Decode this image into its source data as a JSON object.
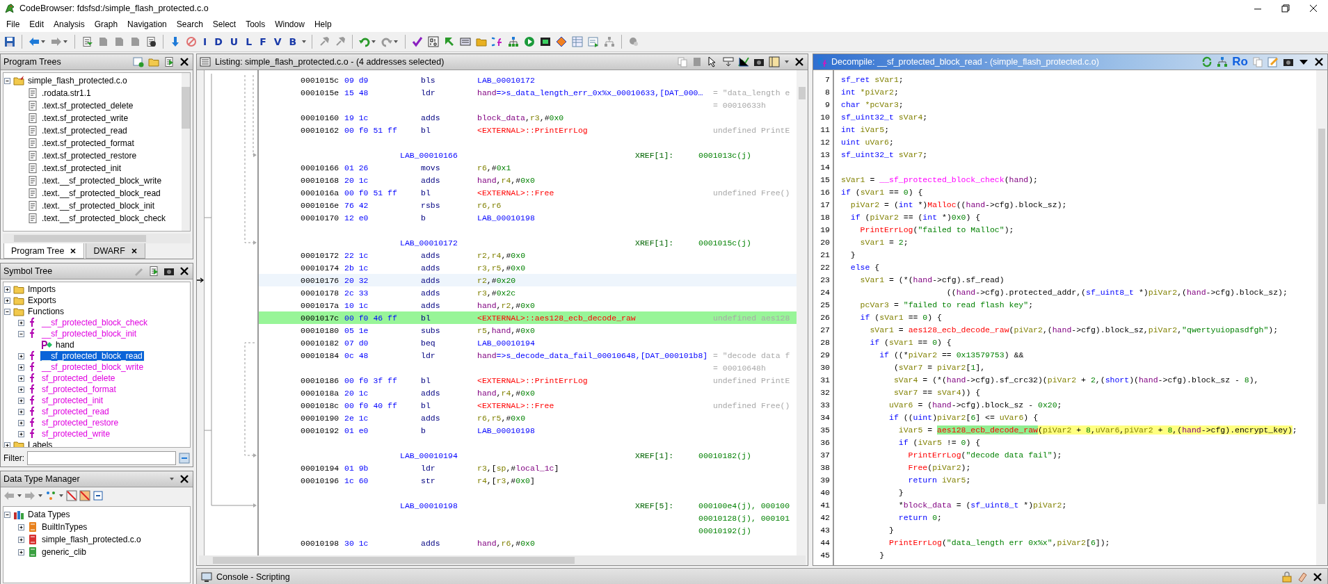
{
  "window": {
    "title": "CodeBrowser: fdsfsd:/simple_flash_protected.c.o"
  },
  "menu": [
    "File",
    "Edit",
    "Analysis",
    "Graph",
    "Navigation",
    "Search",
    "Select",
    "Tools",
    "Window",
    "Help"
  ],
  "toolbar": {
    "letter_buttons": [
      "I",
      "D",
      "U",
      "L",
      "F",
      "V",
      "B"
    ]
  },
  "program_trees": {
    "title": "Program Trees",
    "items": [
      {
        "label": "simple_flash_protected.c.o",
        "kind": "root",
        "expanded": true,
        "children": [
          {
            "label": ".rodata.str1.1",
            "kind": "fragment"
          },
          {
            "label": ".text.sf_protected_delete",
            "kind": "fragment"
          },
          {
            "label": ".text.sf_protected_write",
            "kind": "fragment"
          },
          {
            "label": ".text.sf_protected_read",
            "kind": "fragment"
          },
          {
            "label": ".text.sf_protected_format",
            "kind": "fragment"
          },
          {
            "label": ".text.sf_protected_restore",
            "kind": "fragment"
          },
          {
            "label": ".text.sf_protected_init",
            "kind": "fragment"
          },
          {
            "label": ".text.__sf_protected_block_write",
            "kind": "fragment"
          },
          {
            "label": ".text.__sf_protected_block_read",
            "kind": "fragment"
          },
          {
            "label": ".text.__sf_protected_block_init",
            "kind": "fragment"
          },
          {
            "label": ".text.__sf_protected_block_check",
            "kind": "fragment"
          }
        ]
      }
    ],
    "tabs": [
      {
        "label": "Program Tree",
        "selected": true
      },
      {
        "label": "DWARF",
        "selected": false
      }
    ]
  },
  "symbol_tree": {
    "title": "Symbol Tree",
    "items": [
      {
        "label": "Imports",
        "kind": "folder",
        "expanded": false,
        "selected": false
      },
      {
        "label": "Exports",
        "kind": "folder",
        "expanded": false,
        "selected": false
      },
      {
        "label": "Functions",
        "kind": "folder",
        "expanded": true,
        "selected": false,
        "children": [
          {
            "label": "__sf_protected_block_check",
            "kind": "function",
            "expanded": false,
            "selected": false
          },
          {
            "label": "__sf_protected_block_init",
            "kind": "function",
            "expanded": true,
            "selected": false,
            "children": [
              {
                "label": "hand",
                "kind": "param",
                "selected": false
              }
            ]
          },
          {
            "label": "__sf_protected_block_read",
            "kind": "function",
            "expanded": false,
            "selected": true
          },
          {
            "label": "__sf_protected_block_write",
            "kind": "function",
            "expanded": false,
            "selected": false
          },
          {
            "label": "sf_protected_delete",
            "kind": "function",
            "expanded": false,
            "selected": false
          },
          {
            "label": "sf_protected_format",
            "kind": "function",
            "expanded": false,
            "selected": false
          },
          {
            "label": "sf_protected_init",
            "kind": "function",
            "expanded": false,
            "selected": false
          },
          {
            "label": "sf_protected_read",
            "kind": "function",
            "expanded": false,
            "selected": false
          },
          {
            "label": "sf_protected_restore",
            "kind": "function",
            "expanded": false,
            "selected": false
          },
          {
            "label": "sf_protected_write",
            "kind": "function",
            "expanded": false,
            "selected": false
          }
        ]
      },
      {
        "label": "Labels",
        "kind": "folder",
        "expanded": false,
        "selected": false
      }
    ],
    "filter": {
      "label": "Filter:"
    }
  },
  "data_type_manager": {
    "title": "Data Type Manager",
    "items": [
      {
        "label": "Data Types",
        "kind": "root",
        "expanded": true,
        "children": [
          {
            "label": "BuiltInTypes",
            "kind": "archive",
            "color": "#e8801c",
            "expanded": false
          },
          {
            "label": "simple_flash_protected.c.o",
            "kind": "archive",
            "color": "#d83030",
            "expanded": false
          },
          {
            "label": "generic_clib",
            "kind": "archive",
            "color": "#3aa040",
            "expanded": false
          }
        ]
      }
    ]
  },
  "listing": {
    "title": "Listing:  simple_flash_protected.c.o - (4 addresses selected)",
    "rows": [
      {
        "kind": "instr",
        "address": "0001015c",
        "bytes": "09 d9",
        "mnemonic": "bls",
        "operands": [
          {
            "kind": "label",
            "text": "LAB_00010172"
          }
        ],
        "selected": false,
        "cursor": false
      },
      {
        "kind": "instr",
        "address": "0001015e",
        "bytes": "15 48",
        "mnemonic": "ldr",
        "operands": [
          {
            "kind": "param",
            "text": "hand"
          },
          {
            "kind": "label",
            "text": "=>s_data_length_err_0x%x_00010633,[DAT_000…"
          }
        ],
        "comment": "= \"data_length e",
        "selected": false,
        "cursor": false
      },
      {
        "kind": "note",
        "comment": "= 00010633h"
      },
      {
        "kind": "instr",
        "address": "00010160",
        "bytes": "19 1c",
        "mnemonic": "adds",
        "operands": [
          {
            "kind": "param",
            "text": "block_data"
          },
          {
            "kind": "plain",
            "text": ","
          },
          {
            "kind": "reg",
            "text": "r3"
          },
          {
            "kind": "plain",
            "text": ",#"
          },
          {
            "kind": "num",
            "text": "0x0"
          }
        ],
        "selected": false,
        "cursor": false
      },
      {
        "kind": "instr",
        "address": "00010162",
        "bytes": "00 f0 51 ff",
        "mnemonic": "bl",
        "operands": [
          {
            "kind": "ext",
            "text": "<EXTERNAL>::PrintErrLog"
          }
        ],
        "comment": "undefined PrintE",
        "selected": false,
        "cursor": false
      },
      {
        "kind": "blank"
      },
      {
        "kind": "label",
        "label": "LAB_00010166",
        "xref": "XREF[1]:",
        "refs": [
          "0001013c(j)"
        ]
      },
      {
        "kind": "instr",
        "address": "00010166",
        "bytes": "01 26",
        "mnemonic": "movs",
        "operands": [
          {
            "kind": "reg",
            "text": "r6"
          },
          {
            "kind": "plain",
            "text": ",#"
          },
          {
            "kind": "num",
            "text": "0x1"
          }
        ],
        "selected": false,
        "cursor": false
      },
      {
        "kind": "instr",
        "address": "00010168",
        "bytes": "20 1c",
        "mnemonic": "adds",
        "operands": [
          {
            "kind": "param",
            "text": "hand"
          },
          {
            "kind": "plain",
            "text": ","
          },
          {
            "kind": "reg",
            "text": "r4"
          },
          {
            "kind": "plain",
            "text": ",#"
          },
          {
            "kind": "num",
            "text": "0x0"
          }
        ],
        "selected": false,
        "cursor": false
      },
      {
        "kind": "instr",
        "address": "0001016a",
        "bytes": "00 f0 51 ff",
        "mnemonic": "bl",
        "operands": [
          {
            "kind": "ext",
            "text": "<EXTERNAL>::Free"
          }
        ],
        "comment": "undefined Free()",
        "selected": false,
        "cursor": false
      },
      {
        "kind": "instr",
        "address": "0001016e",
        "bytes": "76 42",
        "mnemonic": "rsbs",
        "operands": [
          {
            "kind": "reg",
            "text": "r6,r6"
          }
        ],
        "selected": false,
        "cursor": false
      },
      {
        "kind": "instr",
        "address": "00010170",
        "bytes": "12 e0",
        "mnemonic": "b",
        "operands": [
          {
            "kind": "label",
            "text": "LAB_00010198"
          }
        ],
        "selected": false,
        "cursor": false
      },
      {
        "kind": "blank"
      },
      {
        "kind": "label",
        "label": "LAB_00010172",
        "xref": "XREF[1]:",
        "refs": [
          "0001015c(j)"
        ]
      },
      {
        "kind": "instr",
        "address": "00010172",
        "bytes": "22 1c",
        "mnemonic": "adds",
        "operands": [
          {
            "kind": "reg",
            "text": "r2,r4"
          },
          {
            "kind": "plain",
            "text": ",#"
          },
          {
            "kind": "num",
            "text": "0x0"
          }
        ],
        "selected": false,
        "cursor": false
      },
      {
        "kind": "instr",
        "address": "00010174",
        "bytes": "2b 1c",
        "mnemonic": "adds",
        "operands": [
          {
            "kind": "reg",
            "text": "r3,r5"
          },
          {
            "kind": "plain",
            "text": ",#"
          },
          {
            "kind": "num",
            "text": "0x0"
          }
        ],
        "selected": false,
        "cursor": false
      },
      {
        "kind": "instr",
        "address": "00010176",
        "bytes": "20 32",
        "mnemonic": "adds",
        "operands": [
          {
            "kind": "reg",
            "text": "r2"
          },
          {
            "kind": "plain",
            "text": ",#"
          },
          {
            "kind": "num",
            "text": "0x20"
          }
        ],
        "selected": false,
        "cursor": true
      },
      {
        "kind": "instr",
        "address": "00010178",
        "bytes": "2c 33",
        "mnemonic": "adds",
        "operands": [
          {
            "kind": "reg",
            "text": "r3"
          },
          {
            "kind": "plain",
            "text": ",#"
          },
          {
            "kind": "num",
            "text": "0x2c"
          }
        ],
        "selected": false,
        "cursor": false
      },
      {
        "kind": "instr",
        "address": "0001017a",
        "bytes": "10 1c",
        "mnemonic": "adds",
        "operands": [
          {
            "kind": "param",
            "text": "hand"
          },
          {
            "kind": "plain",
            "text": ","
          },
          {
            "kind": "reg",
            "text": "r2"
          },
          {
            "kind": "plain",
            "text": ",#"
          },
          {
            "kind": "num",
            "text": "0x0"
          }
        ],
        "selected": false,
        "cursor": false
      },
      {
        "kind": "instr",
        "address": "0001017c",
        "bytes": "00 f0 46 ff",
        "mnemonic": "bl",
        "operands": [
          {
            "kind": "ext",
            "text": "<EXTERNAL>::aes128_ecb_decode_raw"
          }
        ],
        "comment": "undefined aes128",
        "selected": true,
        "cursor": false
      },
      {
        "kind": "instr",
        "address": "00010180",
        "bytes": "05 1e",
        "mnemonic": "subs",
        "operands": [
          {
            "kind": "reg",
            "text": "r5"
          },
          {
            "kind": "plain",
            "text": ","
          },
          {
            "kind": "param",
            "text": "hand"
          },
          {
            "kind": "plain",
            "text": ",#"
          },
          {
            "kind": "num",
            "text": "0x0"
          }
        ],
        "selected": false,
        "cursor": false
      },
      {
        "kind": "instr",
        "address": "00010182",
        "bytes": "07 d0",
        "mnemonic": "beq",
        "operands": [
          {
            "kind": "label",
            "text": "LAB_00010194"
          }
        ],
        "selected": false,
        "cursor": false
      },
      {
        "kind": "instr",
        "address": "00010184",
        "bytes": "0c 48",
        "mnemonic": "ldr",
        "operands": [
          {
            "kind": "param",
            "text": "hand"
          },
          {
            "kind": "label",
            "text": "=>s_decode_data_fail_00010648,[DAT_000101b8]"
          }
        ],
        "comment": "= \"decode data f",
        "selected": false,
        "cursor": false
      },
      {
        "kind": "note",
        "comment": "= 00010648h"
      },
      {
        "kind": "instr",
        "address": "00010186",
        "bytes": "00 f0 3f ff",
        "mnemonic": "bl",
        "operands": [
          {
            "kind": "ext",
            "text": "<EXTERNAL>::PrintErrLog"
          }
        ],
        "comment": "undefined PrintE",
        "selected": false,
        "cursor": false
      },
      {
        "kind": "instr",
        "address": "0001018a",
        "bytes": "20 1c",
        "mnemonic": "adds",
        "operands": [
          {
            "kind": "param",
            "text": "hand"
          },
          {
            "kind": "plain",
            "text": ","
          },
          {
            "kind": "reg",
            "text": "r4"
          },
          {
            "kind": "plain",
            "text": ",#"
          },
          {
            "kind": "num",
            "text": "0x0"
          }
        ],
        "selected": false,
        "cursor": false
      },
      {
        "kind": "instr",
        "address": "0001018c",
        "bytes": "00 f0 40 ff",
        "mnemonic": "bl",
        "operands": [
          {
            "kind": "ext",
            "text": "<EXTERNAL>::Free"
          }
        ],
        "comment": "undefined Free()",
        "selected": false,
        "cursor": false
      },
      {
        "kind": "instr",
        "address": "00010190",
        "bytes": "2e 1c",
        "mnemonic": "adds",
        "operands": [
          {
            "kind": "reg",
            "text": "r6,r5"
          },
          {
            "kind": "plain",
            "text": ",#"
          },
          {
            "kind": "num",
            "text": "0x0"
          }
        ],
        "selected": false,
        "cursor": false
      },
      {
        "kind": "instr",
        "address": "00010192",
        "bytes": "01 e0",
        "mnemonic": "b",
        "operands": [
          {
            "kind": "label",
            "text": "LAB_00010198"
          }
        ],
        "selected": false,
        "cursor": false
      },
      {
        "kind": "blank"
      },
      {
        "kind": "label",
        "label": "LAB_00010194",
        "xref": "XREF[1]:",
        "refs": [
          "00010182(j)"
        ]
      },
      {
        "kind": "instr",
        "address": "00010194",
        "bytes": "01 9b",
        "mnemonic": "ldr",
        "operands": [
          {
            "kind": "reg",
            "text": "r3"
          },
          {
            "kind": "plain",
            "text": ",["
          },
          {
            "kind": "reg",
            "text": "sp"
          },
          {
            "kind": "plain",
            "text": ",#"
          },
          {
            "kind": "param",
            "text": "local_1c"
          },
          {
            "kind": "plain",
            "text": "]"
          }
        ],
        "selected": false,
        "cursor": false
      },
      {
        "kind": "instr",
        "address": "00010196",
        "bytes": "1c 60",
        "mnemonic": "str",
        "operands": [
          {
            "kind": "reg",
            "text": "r4"
          },
          {
            "kind": "plain",
            "text": ",["
          },
          {
            "kind": "reg",
            "text": "r3"
          },
          {
            "kind": "plain",
            "text": ",#"
          },
          {
            "kind": "num",
            "text": "0x0"
          },
          {
            "kind": "plain",
            "text": "]"
          }
        ],
        "selected": false,
        "cursor": false
      },
      {
        "kind": "blank"
      },
      {
        "kind": "label",
        "label": "LAB_00010198",
        "xref": "XREF[5]:",
        "refs": [
          "000100e4(j), 000100",
          "00010128(j), 000101",
          "00010192(j)"
        ]
      },
      {
        "kind": "instr",
        "address": "00010198",
        "bytes": "30 1c",
        "mnemonic": "adds",
        "operands": [
          {
            "kind": "param",
            "text": "hand"
          },
          {
            "kind": "plain",
            "text": ","
          },
          {
            "kind": "reg",
            "text": "r6"
          },
          {
            "kind": "plain",
            "text": ",#"
          },
          {
            "kind": "num",
            "text": "0x0"
          }
        ],
        "selected": false,
        "cursor": false
      }
    ]
  },
  "decompile": {
    "title": "Decompile: __sf_protected_block_read -  (simple_flash_protected.c.o)",
    "badge": "Ro",
    "lines": [
      {
        "number": "7",
        "code": [
          {
            "kind": "kw",
            "text": "sf_ret"
          },
          {
            "kind": "var",
            "text": " sVar1"
          },
          {
            "kind": "plain",
            "text": ";"
          }
        ]
      },
      {
        "number": "8",
        "code": [
          {
            "kind": "kw",
            "text": "int"
          },
          {
            "kind": "var",
            "text": " *piVar2"
          },
          {
            "kind": "plain",
            "text": ";"
          }
        ]
      },
      {
        "number": "9",
        "code": [
          {
            "kind": "kw",
            "text": "char"
          },
          {
            "kind": "var",
            "text": " *pcVar3"
          },
          {
            "kind": "plain",
            "text": ";"
          }
        ]
      },
      {
        "number": "10",
        "code": [
          {
            "kind": "kw",
            "text": "sf_uint32_t"
          },
          {
            "kind": "var",
            "text": " sVar4"
          },
          {
            "kind": "plain",
            "text": ";"
          }
        ]
      },
      {
        "number": "11",
        "code": [
          {
            "kind": "kw",
            "text": "int"
          },
          {
            "kind": "var",
            "text": " iVar5"
          },
          {
            "kind": "plain",
            "text": ";"
          }
        ]
      },
      {
        "number": "12",
        "code": [
          {
            "kind": "kw",
            "text": "uint"
          },
          {
            "kind": "var",
            "text": " uVar6"
          },
          {
            "kind": "plain",
            "text": ";"
          }
        ]
      },
      {
        "number": "13",
        "code": [
          {
            "kind": "kw",
            "text": "sf_uint32_t"
          },
          {
            "kind": "var",
            "text": " sVar7"
          },
          {
            "kind": "plain",
            "text": ";"
          }
        ]
      },
      {
        "number": "14"
      },
      {
        "number": "15",
        "code": [
          {
            "kind": "var",
            "text": "sVar1"
          },
          {
            "kind": "plain",
            "text": " = "
          },
          {
            "kind": "fn",
            "text": "__sf_protected_block_check"
          },
          {
            "kind": "plain",
            "text": "("
          },
          {
            "kind": "param",
            "text": "hand"
          },
          {
            "kind": "plain",
            "text": ");"
          }
        ]
      },
      {
        "number": "16",
        "code": [
          {
            "kind": "kw",
            "text": "if"
          },
          {
            "kind": "plain",
            "text": " ("
          },
          {
            "kind": "var",
            "text": "sVar1"
          },
          {
            "kind": "plain",
            "text": " == "
          },
          {
            "kind": "num",
            "text": "0"
          },
          {
            "kind": "plain",
            "text": ") {"
          }
        ]
      },
      {
        "number": "17",
        "code": [
          {
            "kind": "var",
            "text": "  piVar2"
          },
          {
            "kind": "plain",
            "text": " = ("
          },
          {
            "kind": "kw",
            "text": "int"
          },
          {
            "kind": "plain",
            "text": " *)"
          },
          {
            "kind": "ext",
            "text": "Malloc"
          },
          {
            "kind": "plain",
            "text": "(("
          },
          {
            "kind": "param",
            "text": "hand"
          },
          {
            "kind": "plain",
            "text": "->cfg).block_sz);"
          }
        ]
      },
      {
        "number": "18",
        "code": [
          {
            "kind": "kw",
            "text": "  if"
          },
          {
            "kind": "plain",
            "text": " ("
          },
          {
            "kind": "var",
            "text": "piVar2"
          },
          {
            "kind": "plain",
            "text": " == ("
          },
          {
            "kind": "kw",
            "text": "int"
          },
          {
            "kind": "plain",
            "text": " *)"
          },
          {
            "kind": "num",
            "text": "0x0"
          },
          {
            "kind": "plain",
            "text": ") {"
          }
        ]
      },
      {
        "number": "19",
        "code": [
          {
            "kind": "ext",
            "text": "    PrintErrLog"
          },
          {
            "kind": "plain",
            "text": "("
          },
          {
            "kind": "str",
            "text": "\"failed to Malloc\""
          },
          {
            "kind": "plain",
            "text": ");"
          }
        ]
      },
      {
        "number": "20",
        "code": [
          {
            "kind": "var",
            "text": "    sVar1"
          },
          {
            "kind": "plain",
            "text": " = "
          },
          {
            "kind": "num",
            "text": "2"
          },
          {
            "kind": "plain",
            "text": ";"
          }
        ]
      },
      {
        "number": "21",
        "code": [
          {
            "kind": "plain",
            "text": "  }"
          }
        ]
      },
      {
        "number": "22",
        "code": [
          {
            "kind": "kw",
            "text": "  else"
          },
          {
            "kind": "plain",
            "text": " {"
          }
        ]
      },
      {
        "number": "23",
        "code": [
          {
            "kind": "var",
            "text": "    sVar1"
          },
          {
            "kind": "plain",
            "text": " = (*("
          },
          {
            "kind": "param",
            "text": "hand"
          },
          {
            "kind": "plain",
            "text": "->cfg).sf_read)"
          }
        ]
      },
      {
        "number": "24",
        "code": [
          {
            "kind": "plain",
            "text": "                      (("
          },
          {
            "kind": "param",
            "text": "hand"
          },
          {
            "kind": "plain",
            "text": "->cfg).protected_addr,("
          },
          {
            "kind": "kw",
            "text": "sf_uint8_t"
          },
          {
            "kind": "plain",
            "text": " *)"
          },
          {
            "kind": "var",
            "text": "piVar2"
          },
          {
            "kind": "plain",
            "text": ",("
          },
          {
            "kind": "param",
            "text": "hand"
          },
          {
            "kind": "plain",
            "text": "->cfg).block_sz);"
          }
        ]
      },
      {
        "number": "25",
        "code": [
          {
            "kind": "var",
            "text": "    pcVar3"
          },
          {
            "kind": "plain",
            "text": " = "
          },
          {
            "kind": "str",
            "text": "\"failed to read flash key\""
          },
          {
            "kind": "plain",
            "text": ";"
          }
        ]
      },
      {
        "number": "26",
        "code": [
          {
            "kind": "kw",
            "text": "    if"
          },
          {
            "kind": "plain",
            "text": " ("
          },
          {
            "kind": "var",
            "text": "sVar1"
          },
          {
            "kind": "plain",
            "text": " == "
          },
          {
            "kind": "num",
            "text": "0"
          },
          {
            "kind": "plain",
            "text": ") {"
          }
        ]
      },
      {
        "number": "27",
        "code": [
          {
            "kind": "var",
            "text": "      sVar1"
          },
          {
            "kind": "plain",
            "text": " = "
          },
          {
            "kind": "ext",
            "text": "aes128_ecb_decode_raw"
          },
          {
            "kind": "plain",
            "text": "("
          },
          {
            "kind": "var",
            "text": "piVar2"
          },
          {
            "kind": "plain",
            "text": ",("
          },
          {
            "kind": "param",
            "text": "hand"
          },
          {
            "kind": "plain",
            "text": "->cfg).block_sz,"
          },
          {
            "kind": "var",
            "text": "piVar2"
          },
          {
            "kind": "plain",
            "text": ","
          },
          {
            "kind": "str",
            "text": "\"qwertyuiopasdfgh\""
          },
          {
            "kind": "plain",
            "text": ");"
          }
        ]
      },
      {
        "number": "28",
        "code": [
          {
            "kind": "kw",
            "text": "      if"
          },
          {
            "kind": "plain",
            "text": " ("
          },
          {
            "kind": "var",
            "text": "sVar1"
          },
          {
            "kind": "plain",
            "text": " == "
          },
          {
            "kind": "num",
            "text": "0"
          },
          {
            "kind": "plain",
            "text": ") {"
          }
        ]
      },
      {
        "number": "29",
        "code": [
          {
            "kind": "kw",
            "text": "        if"
          },
          {
            "kind": "plain",
            "text": " ((*"
          },
          {
            "kind": "var",
            "text": "piVar2"
          },
          {
            "kind": "plain",
            "text": " == "
          },
          {
            "kind": "num",
            "text": "0x13579753"
          },
          {
            "kind": "plain",
            "text": ") &&"
          }
        ]
      },
      {
        "number": "30",
        "code": [
          {
            "kind": "plain",
            "text": "           ("
          },
          {
            "kind": "var",
            "text": "sVar7"
          },
          {
            "kind": "plain",
            "text": " = "
          },
          {
            "kind": "var",
            "text": "piVar2"
          },
          {
            "kind": "plain",
            "text": "["
          },
          {
            "kind": "num",
            "text": "1"
          },
          {
            "kind": "plain",
            "text": "],"
          }
        ]
      },
      {
        "number": "31",
        "code": [
          {
            "kind": "var",
            "text": "           sVar4"
          },
          {
            "kind": "plain",
            "text": " = (*("
          },
          {
            "kind": "param",
            "text": "hand"
          },
          {
            "kind": "plain",
            "text": "->cfg).sf_crc32)("
          },
          {
            "kind": "var",
            "text": "piVar2"
          },
          {
            "kind": "plain",
            "text": " + "
          },
          {
            "kind": "num",
            "text": "2"
          },
          {
            "kind": "plain",
            "text": ",("
          },
          {
            "kind": "kw",
            "text": "short"
          },
          {
            "kind": "plain",
            "text": ")("
          },
          {
            "kind": "param",
            "text": "hand"
          },
          {
            "kind": "plain",
            "text": "->cfg).block_sz - "
          },
          {
            "kind": "num",
            "text": "8"
          },
          {
            "kind": "plain",
            "text": "),"
          }
        ]
      },
      {
        "number": "32",
        "code": [
          {
            "kind": "var",
            "text": "           sVar7"
          },
          {
            "kind": "plain",
            "text": " == "
          },
          {
            "kind": "var",
            "text": "sVar4"
          },
          {
            "kind": "plain",
            "text": ")) {"
          }
        ]
      },
      {
        "number": "33",
        "code": [
          {
            "kind": "var",
            "text": "          uVar6"
          },
          {
            "kind": "plain",
            "text": " = ("
          },
          {
            "kind": "param",
            "text": "hand"
          },
          {
            "kind": "plain",
            "text": "->cfg).block_sz - "
          },
          {
            "kind": "num",
            "text": "0x20"
          },
          {
            "kind": "plain",
            "text": ";"
          }
        ]
      },
      {
        "number": "34",
        "code": [
          {
            "kind": "kw",
            "text": "          if"
          },
          {
            "kind": "plain",
            "text": " (("
          },
          {
            "kind": "kw",
            "text": "uint"
          },
          {
            "kind": "plain",
            "text": ")"
          },
          {
            "kind": "var",
            "text": "piVar2"
          },
          {
            "kind": "plain",
            "text": "["
          },
          {
            "kind": "num",
            "text": "6"
          },
          {
            "kind": "plain",
            "text": "] <= "
          },
          {
            "kind": "var",
            "text": "uVar6"
          },
          {
            "kind": "plain",
            "text": ") {"
          }
        ]
      },
      {
        "number": "35",
        "code": [
          {
            "kind": "var",
            "text": "            iVar5"
          },
          {
            "kind": "plain",
            "text": " = "
          }
        ],
        "highlight": [
          {
            "kind": "match",
            "text": "aes128_ecb_decode_raw"
          },
          {
            "kind": "plain",
            "text": "("
          },
          {
            "kind": "var",
            "text": "piVar2"
          },
          {
            "kind": "plain",
            "text": " + "
          },
          {
            "kind": "num",
            "text": "8"
          },
          {
            "kind": "plain",
            "text": ","
          },
          {
            "kind": "var",
            "text": "uVar6"
          },
          {
            "kind": "plain",
            "text": ","
          },
          {
            "kind": "var",
            "text": "piVar2"
          },
          {
            "kind": "plain",
            "text": " + "
          },
          {
            "kind": "num",
            "text": "8"
          },
          {
            "kind": "plain",
            "text": ",("
          },
          {
            "kind": "param",
            "text": "hand"
          },
          {
            "kind": "plain",
            "text": "->cfg).encrypt_key)"
          }
        ],
        "rest": [
          {
            "kind": "plain",
            "text": ";"
          }
        ]
      },
      {
        "number": "36",
        "code": [
          {
            "kind": "kw",
            "text": "            if"
          },
          {
            "kind": "plain",
            "text": " ("
          },
          {
            "kind": "var",
            "text": "iVar5"
          },
          {
            "kind": "plain",
            "text": " != "
          },
          {
            "kind": "num",
            "text": "0"
          },
          {
            "kind": "plain",
            "text": ") {"
          }
        ]
      },
      {
        "number": "37",
        "code": [
          {
            "kind": "ext",
            "text": "              PrintErrLog"
          },
          {
            "kind": "plain",
            "text": "("
          },
          {
            "kind": "str",
            "text": "\"decode data fail\""
          },
          {
            "kind": "plain",
            "text": ");"
          }
        ]
      },
      {
        "number": "38",
        "code": [
          {
            "kind": "ext",
            "text": "              Free"
          },
          {
            "kind": "plain",
            "text": "("
          },
          {
            "kind": "var",
            "text": "piVar2"
          },
          {
            "kind": "plain",
            "text": ");"
          }
        ]
      },
      {
        "number": "39",
        "code": [
          {
            "kind": "kw",
            "text": "              return"
          },
          {
            "kind": "var",
            "text": " iVar5"
          },
          {
            "kind": "plain",
            "text": ";"
          }
        ]
      },
      {
        "number": "40",
        "code": [
          {
            "kind": "plain",
            "text": "            }"
          }
        ]
      },
      {
        "number": "41",
        "code": [
          {
            "kind": "plain",
            "text": "            *"
          },
          {
            "kind": "param",
            "text": "block_data"
          },
          {
            "kind": "plain",
            "text": " = ("
          },
          {
            "kind": "kw",
            "text": "sf_uint8_t"
          },
          {
            "kind": "plain",
            "text": " *)"
          },
          {
            "kind": "var",
            "text": "piVar2"
          },
          {
            "kind": "plain",
            "text": ";"
          }
        ]
      },
      {
        "number": "42",
        "code": [
          {
            "kind": "kw",
            "text": "            return"
          },
          {
            "kind": "num",
            "text": " 0"
          },
          {
            "kind": "plain",
            "text": ";"
          }
        ]
      },
      {
        "number": "43",
        "code": [
          {
            "kind": "plain",
            "text": "          }"
          }
        ]
      },
      {
        "number": "44",
        "code": [
          {
            "kind": "ext",
            "text": "          PrintErrLog"
          },
          {
            "kind": "plain",
            "text": "("
          },
          {
            "kind": "str",
            "text": "\"data_length err 0x%x\""
          },
          {
            "kind": "plain",
            "text": ","
          },
          {
            "kind": "var",
            "text": "piVar2"
          },
          {
            "kind": "plain",
            "text": "["
          },
          {
            "kind": "num",
            "text": "6"
          },
          {
            "kind": "plain",
            "text": "]);"
          }
        ]
      },
      {
        "number": "45",
        "code": [
          {
            "kind": "plain",
            "text": "        }"
          }
        ]
      }
    ]
  },
  "console": {
    "title": "Console - Scripting"
  }
}
